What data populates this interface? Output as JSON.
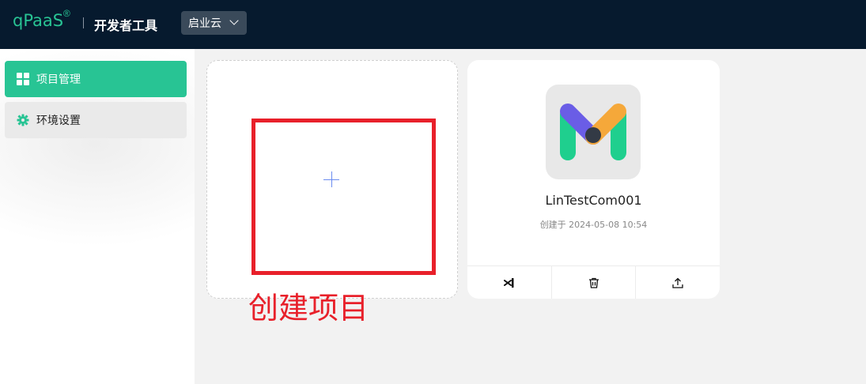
{
  "header": {
    "logo": "qPaaS",
    "logo_mark": "®",
    "app_name": "开发者工具",
    "org": "启业云"
  },
  "sidebar": {
    "items": [
      {
        "label": "项目管理",
        "icon": "grid-icon",
        "active": true
      },
      {
        "label": "环境设置",
        "icon": "gear-icon",
        "active": false
      }
    ]
  },
  "main": {
    "create_card": {
      "annotation": "创建项目",
      "icon": "plus-icon"
    },
    "projects": [
      {
        "name": "LinTestCom001",
        "created": "创建于 2024-05-08 10:54",
        "actions": [
          "vscode-icon",
          "trash-icon",
          "upload-icon"
        ]
      }
    ]
  },
  "colors": {
    "topbar": "#061a2e",
    "accent": "#28c494",
    "annotation": "#e8202a"
  }
}
